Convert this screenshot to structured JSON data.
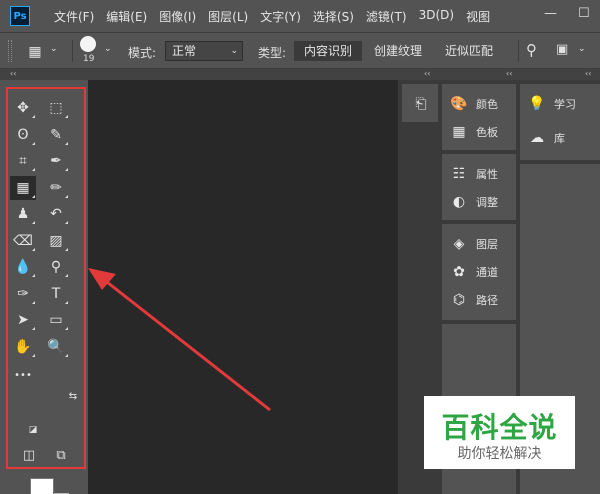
{
  "app": {
    "logo_text": "Ps"
  },
  "menu": [
    "文件(F)",
    "编辑(E)",
    "图像(I)",
    "图层(L)",
    "文字(Y)",
    "选择(S)",
    "滤镜(T)",
    "3D(D)",
    "视图"
  ],
  "window_controls": {
    "minimize": "—",
    "maximize": "☐"
  },
  "options_bar": {
    "brush_size": "19",
    "mode_label": "模式:",
    "mode_value": "正常",
    "type_label": "类型:",
    "type_options": [
      "内容识别",
      "创建纹理",
      "近似匹配"
    ]
  },
  "collapse_chevron": "‹‹",
  "tools": [
    {
      "name": "move-tool",
      "glyph": "✥"
    },
    {
      "name": "marquee-tool",
      "glyph": "⬚"
    },
    {
      "name": "lasso-tool",
      "glyph": "ʘ"
    },
    {
      "name": "quick-select-tool",
      "glyph": "✎"
    },
    {
      "name": "crop-tool",
      "glyph": "⌗"
    },
    {
      "name": "eyedropper-tool",
      "glyph": "✒"
    },
    {
      "name": "healing-brush-tool",
      "glyph": "▦"
    },
    {
      "name": "brush-tool",
      "glyph": "✏"
    },
    {
      "name": "clone-stamp-tool",
      "glyph": "♟"
    },
    {
      "name": "history-brush-tool",
      "glyph": "↶"
    },
    {
      "name": "eraser-tool",
      "glyph": "⌫"
    },
    {
      "name": "gradient-tool",
      "glyph": "▨"
    },
    {
      "name": "blur-tool",
      "glyph": "💧"
    },
    {
      "name": "dodge-tool",
      "glyph": "⚲"
    },
    {
      "name": "pen-tool",
      "glyph": "✑"
    },
    {
      "name": "type-tool",
      "glyph": "T"
    },
    {
      "name": "path-select-tool",
      "glyph": "➤"
    },
    {
      "name": "rectangle-tool",
      "glyph": "▭"
    },
    {
      "name": "hand-tool",
      "glyph": "✋"
    },
    {
      "name": "zoom-tool",
      "glyph": "🔍"
    },
    {
      "name": "more-tools",
      "glyph": "•••"
    }
  ],
  "panels": {
    "group1": [
      {
        "icon": "palette-icon",
        "glyph": "🎨",
        "label": "颜色"
      },
      {
        "icon": "swatches-icon",
        "glyph": "▦",
        "label": "色板"
      }
    ],
    "group2": [
      {
        "icon": "properties-icon",
        "glyph": "☷",
        "label": "属性"
      },
      {
        "icon": "adjustments-icon",
        "glyph": "◐",
        "label": "调整"
      }
    ],
    "group3": [
      {
        "icon": "layers-icon",
        "glyph": "◈",
        "label": "图层"
      },
      {
        "icon": "channels-icon",
        "glyph": "✿",
        "label": "通道"
      },
      {
        "icon": "paths-icon",
        "glyph": "⌬",
        "label": "路径"
      }
    ],
    "group4": [
      {
        "icon": "learn-icon",
        "glyph": "💡",
        "label": "学习"
      },
      {
        "icon": "libraries-icon",
        "glyph": "☁",
        "label": "库"
      }
    ]
  },
  "watermark": {
    "title": "百科全说",
    "subtitle": "助你轻松解决"
  },
  "colors": {
    "annotation_red": "#e23a3a",
    "watermark_green": "#2fa544"
  }
}
